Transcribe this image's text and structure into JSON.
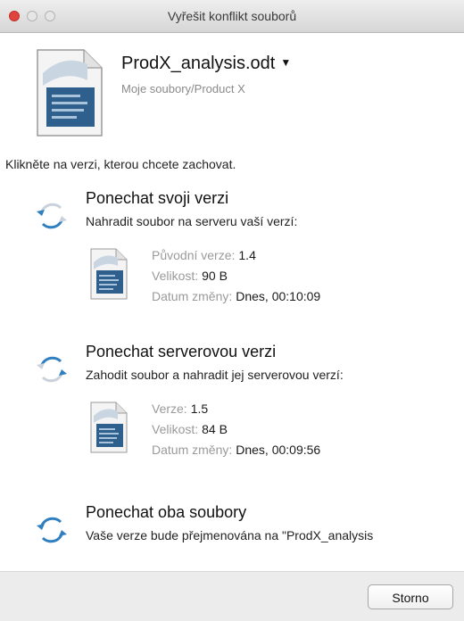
{
  "window": {
    "title": "Vyřešit konflikt souborů"
  },
  "file": {
    "name": "ProdX_analysis.odt",
    "path": "Moje soubory/Product X",
    "icon": "document-icon"
  },
  "instruction": "Klikněte na verzi, kterou chcete zachovat.",
  "options": [
    {
      "title": "Ponechat svoji verzi",
      "description": "Nahradit soubor na serveru vaší verzí:",
      "icon": "sync-icon",
      "details": [
        {
          "label": "Původní verze:",
          "value": "1.4"
        },
        {
          "label": "Velikost:",
          "value": "90 B"
        },
        {
          "label": "Datum změny:",
          "value": "Dnes, 00:10:09"
        }
      ]
    },
    {
      "title": "Ponechat serverovou verzi",
      "description": "Zahodit soubor a nahradit jej serverovou verzí:",
      "icon": "sync-icon",
      "details": [
        {
          "label": "Verze:",
          "value": "1.5"
        },
        {
          "label": "Velikost:",
          "value": "84 B"
        },
        {
          "label": "Datum změny:",
          "value": "Dnes, 00:09:56"
        }
      ]
    },
    {
      "title": "Ponechat oba soubory",
      "description": "Vaše verze bude přejmenována na \"ProdX_analysis",
      "icon": "sync-icon"
    }
  ],
  "footer": {
    "cancel_label": "Storno"
  },
  "colors": {
    "accent": "#2f7fc1",
    "close": "#e0443e"
  }
}
